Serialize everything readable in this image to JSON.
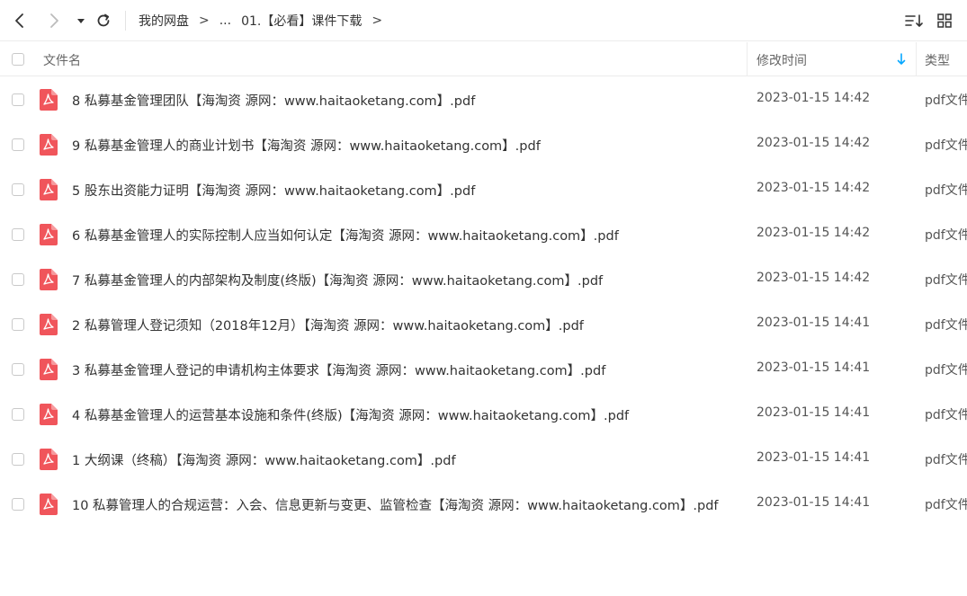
{
  "breadcrumb": {
    "root": "我的网盘",
    "ellipsis": "...",
    "current": "01.【必看】课件下载",
    "separator": ">"
  },
  "columns": {
    "name": "文件名",
    "time": "修改时间",
    "type": "类型"
  },
  "files": [
    {
      "name": "8 私募基金管理团队【海淘资 源网：www.haitaoketang.com】.pdf",
      "time": "2023-01-15 14:42",
      "type": "pdf文件"
    },
    {
      "name": "9 私募基金管理人的商业计划书【海淘资 源网：www.haitaoketang.com】.pdf",
      "time": "2023-01-15 14:42",
      "type": "pdf文件"
    },
    {
      "name": "5 股东出资能力证明【海淘资 源网：www.haitaoketang.com】.pdf",
      "time": "2023-01-15 14:42",
      "type": "pdf文件"
    },
    {
      "name": "6 私募基金管理人的实际控制人应当如何认定【海淘资 源网：www.haitaoketang.com】.pdf",
      "time": "2023-01-15 14:42",
      "type": "pdf文件"
    },
    {
      "name": "7 私募基金管理人的内部架构及制度(终版)【海淘资 源网：www.haitaoketang.com】.pdf",
      "time": "2023-01-15 14:42",
      "type": "pdf文件"
    },
    {
      "name": "2 私募管理人登记须知（2018年12月）【海淘资 源网：www.haitaoketang.com】.pdf",
      "time": "2023-01-15 14:41",
      "type": "pdf文件"
    },
    {
      "name": "3 私募基金管理人登记的申请机构主体要求【海淘资 源网：www.haitaoketang.com】.pdf",
      "time": "2023-01-15 14:41",
      "type": "pdf文件"
    },
    {
      "name": "4 私募基金管理人的运营基本设施和条件(终版)【海淘资 源网：www.haitaoketang.com】.pdf",
      "time": "2023-01-15 14:41",
      "type": "pdf文件"
    },
    {
      "name": "1 大纲课（终稿）【海淘资 源网：www.haitaoketang.com】.pdf",
      "time": "2023-01-15 14:41",
      "type": "pdf文件"
    },
    {
      "name": "10 私募管理人的合规运营：入会、信息更新与变更、监管检查【海淘资 源网：www.haitaoketang.com】.pdf",
      "time": "2023-01-15 14:41",
      "type": "pdf文件"
    }
  ],
  "icons": {
    "back": "chevron-left-icon",
    "forward": "chevron-right-icon",
    "history": "caret-down-icon",
    "refresh": "refresh-icon",
    "sort": "sort-icon",
    "grid": "grid-view-icon",
    "file": "pdf-icon",
    "sort_direction": "arrow-down-icon"
  },
  "colors": {
    "pdf": "#f0555b",
    "accent": "#06a7ff"
  }
}
